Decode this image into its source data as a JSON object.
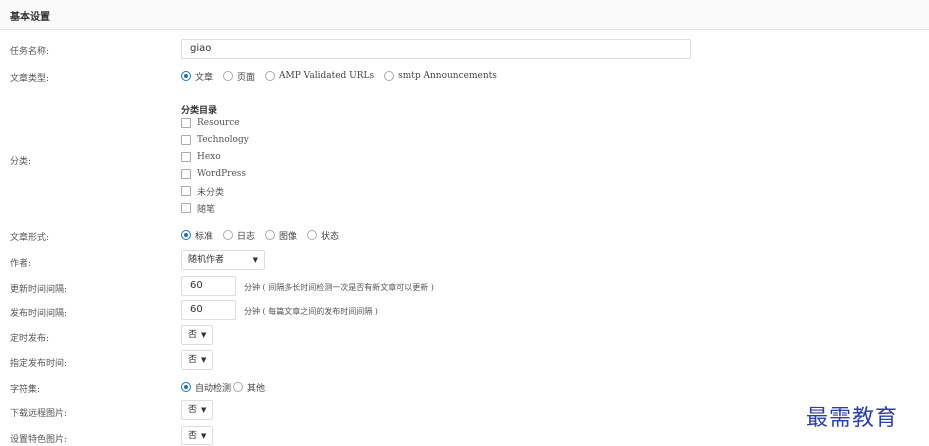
{
  "header": {
    "title": "基本设置"
  },
  "task_name": {
    "label": "任务名称:",
    "value": "giao"
  },
  "post_type": {
    "label": "文章类型:",
    "options": [
      "文章",
      "页面",
      "AMP Validated URLs",
      "smtp Announcements"
    ],
    "selected": 0
  },
  "category": {
    "label": "分类:",
    "title": "分类目录",
    "items": [
      "Resource",
      "Technology",
      "Hexo",
      "WordPress",
      "未分类",
      "随笔"
    ]
  },
  "post_format": {
    "label": "文章形式:",
    "options": [
      "标准",
      "日志",
      "图像",
      "状态"
    ],
    "selected": 0
  },
  "author": {
    "label": "作者:",
    "value": "随机作者"
  },
  "update_interval": {
    "label": "更新时间间隔:",
    "value": "60",
    "hint": "分钟 ( 间隔多长时间检测一次是否有新文章可以更新 )"
  },
  "publish_interval": {
    "label": "发布时间间隔:",
    "value": "60",
    "hint": "分钟 ( 每篇文章之间的发布时间间隔 )"
  },
  "scheduled_publish": {
    "label": "定时发布:",
    "value": "否"
  },
  "fixed_publish_time": {
    "label": "指定发布时间:",
    "value": "否"
  },
  "charset": {
    "label": "字符集:",
    "options": [
      "自动检测",
      "其他"
    ],
    "selected": 0
  },
  "download_remote_images": {
    "label": "下载远程图片:",
    "value": "否"
  },
  "featured_image": {
    "label": "设置特色图片:",
    "value": "否"
  },
  "watermark": "最需教育",
  "colors": {
    "accent": "#2271b1",
    "watermark": "#2b3fa8"
  }
}
